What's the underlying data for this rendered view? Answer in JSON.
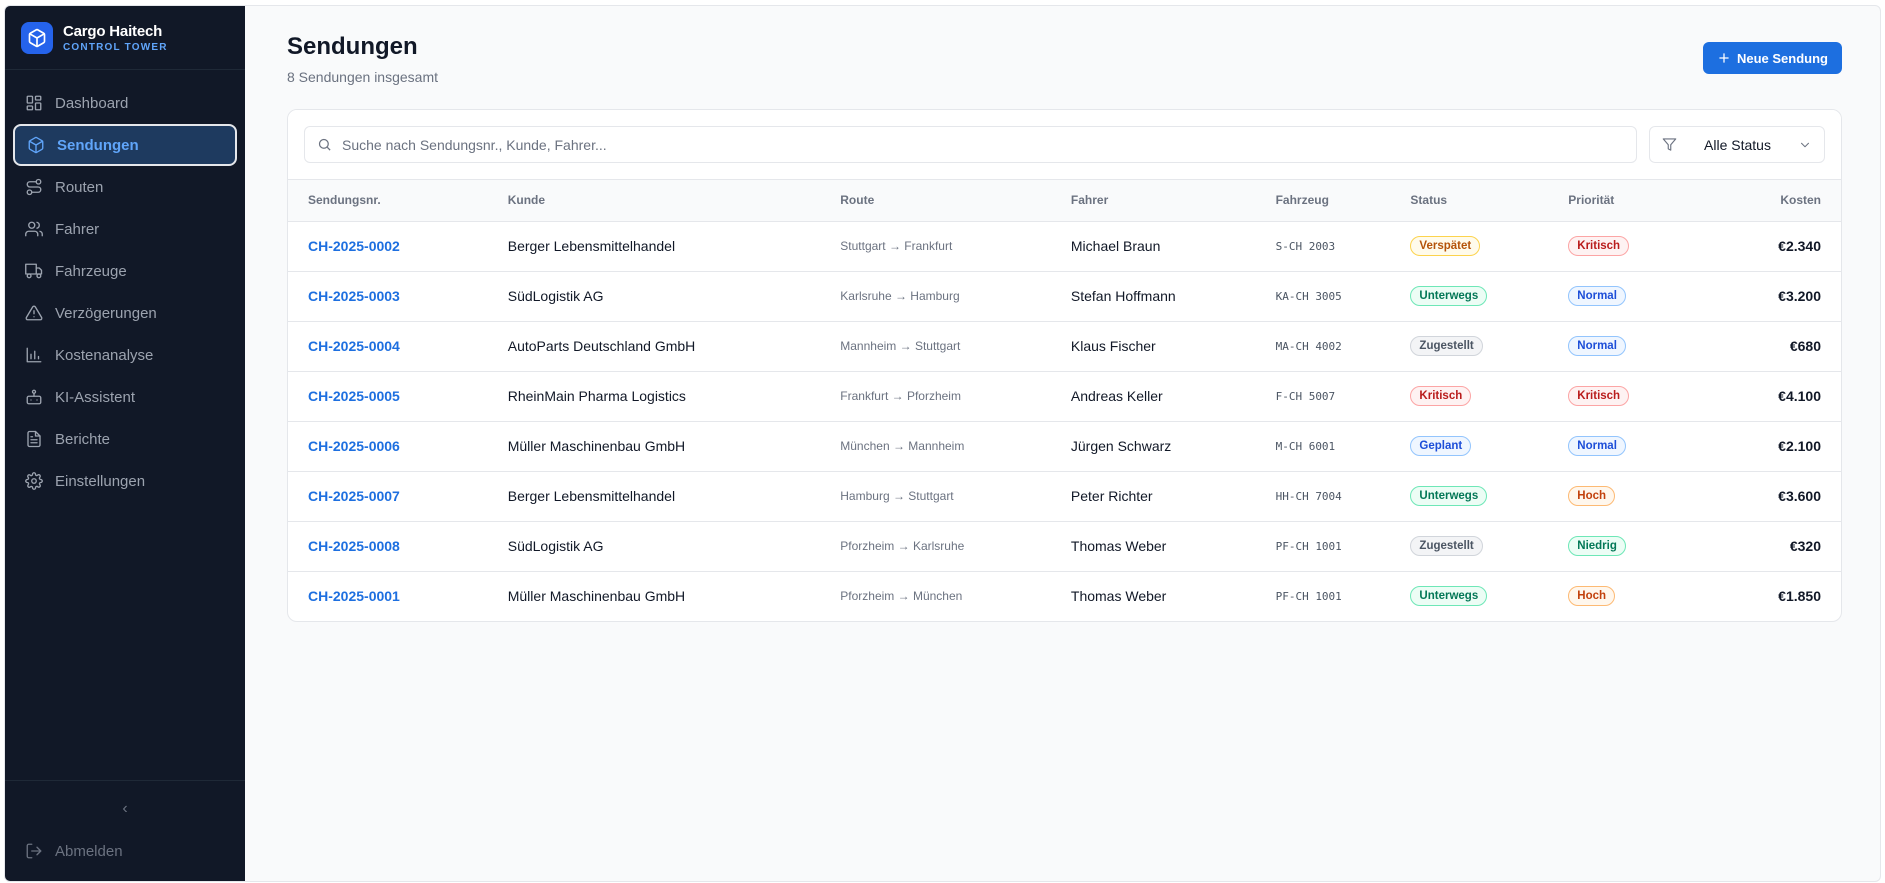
{
  "brand": {
    "name": "Cargo Haitech",
    "subtitle": "CONTROL TOWER"
  },
  "sidebar": {
    "items": [
      {
        "label": "Dashboard",
        "icon": "dashboard-icon"
      },
      {
        "label": "Sendungen",
        "icon": "package-icon",
        "active": true
      },
      {
        "label": "Routen",
        "icon": "route-icon"
      },
      {
        "label": "Fahrer",
        "icon": "users-icon"
      },
      {
        "label": "Fahrzeuge",
        "icon": "truck-icon"
      },
      {
        "label": "Verzögerungen",
        "icon": "warning-icon"
      },
      {
        "label": "Kostenanalyse",
        "icon": "bar-chart-icon"
      },
      {
        "label": "KI-Assistent",
        "icon": "bot-icon"
      },
      {
        "label": "Berichte",
        "icon": "file-icon"
      },
      {
        "label": "Einstellungen",
        "icon": "gear-icon"
      }
    ],
    "collapse_glyph": "‹",
    "logout_label": "Abmelden"
  },
  "header": {
    "title": "Sendungen",
    "subtitle": "8 Sendungen insgesamt",
    "new_button": "Neue Sendung"
  },
  "toolbar": {
    "search_placeholder": "Suche nach Sendungsnr., Kunde, Fahrer...",
    "filter_value": "Alle Status"
  },
  "table": {
    "columns": [
      "Sendungsnr.",
      "Kunde",
      "Route",
      "Fahrer",
      "Fahrzeug",
      "Status",
      "Priorität",
      "Kosten"
    ],
    "rows": [
      {
        "id": "CH-2025-0002",
        "customer": "Berger Lebensmittelhandel",
        "route": "Stuttgart → Frankfurt",
        "driver": "Michael Braun",
        "vehicle": "S-CH 2003",
        "status": "Verspätet",
        "status_color": "amber",
        "priority": "Kritisch",
        "priority_color": "red",
        "cost": "€2.340"
      },
      {
        "id": "CH-2025-0003",
        "customer": "SüdLogistik AG",
        "route": "Karlsruhe → Hamburg",
        "driver": "Stefan Hoffmann",
        "vehicle": "KA-CH 3005",
        "status": "Unterwegs",
        "status_color": "green",
        "priority": "Normal",
        "priority_color": "blue",
        "cost": "€3.200"
      },
      {
        "id": "CH-2025-0004",
        "customer": "AutoParts Deutschland GmbH",
        "route": "Mannheim → Stuttgart",
        "driver": "Klaus Fischer",
        "vehicle": "MA-CH 4002",
        "status": "Zugestellt",
        "status_color": "gray",
        "priority": "Normal",
        "priority_color": "blue",
        "cost": "€680"
      },
      {
        "id": "CH-2025-0005",
        "customer": "RheinMain Pharma Logistics",
        "route": "Frankfurt → Pforzheim",
        "driver": "Andreas Keller",
        "vehicle": "F-CH 5007",
        "status": "Kritisch",
        "status_color": "red",
        "priority": "Kritisch",
        "priority_color": "red",
        "cost": "€4.100"
      },
      {
        "id": "CH-2025-0006",
        "customer": "Müller Maschinenbau GmbH",
        "route": "München → Mannheim",
        "driver": "Jürgen Schwarz",
        "vehicle": "M-CH 6001",
        "status": "Geplant",
        "status_color": "blue",
        "priority": "Normal",
        "priority_color": "blue",
        "cost": "€2.100"
      },
      {
        "id": "CH-2025-0007",
        "customer": "Berger Lebensmittelhandel",
        "route": "Hamburg → Stuttgart",
        "driver": "Peter Richter",
        "vehicle": "HH-CH 7004",
        "status": "Unterwegs",
        "status_color": "green",
        "priority": "Hoch",
        "priority_color": "orange",
        "cost": "€3.600"
      },
      {
        "id": "CH-2025-0008",
        "customer": "SüdLogistik AG",
        "route": "Pforzheim → Karlsruhe",
        "driver": "Thomas Weber",
        "vehicle": "PF-CH 1001",
        "status": "Zugestellt",
        "status_color": "gray",
        "priority": "Niedrig",
        "priority_color": "green",
        "cost": "€320"
      },
      {
        "id": "CH-2025-0001",
        "customer": "Müller Maschinenbau GmbH",
        "route": "Pforzheim → München",
        "driver": "Thomas Weber",
        "vehicle": "PF-CH 1001",
        "status": "Unterwegs",
        "status_color": "green",
        "priority": "Hoch",
        "priority_color": "orange",
        "cost": "€1.850"
      }
    ]
  },
  "colors": {
    "sidebar_bg": "#111827",
    "accent": "#1d6fe0",
    "active_text": "#60a5fa"
  }
}
